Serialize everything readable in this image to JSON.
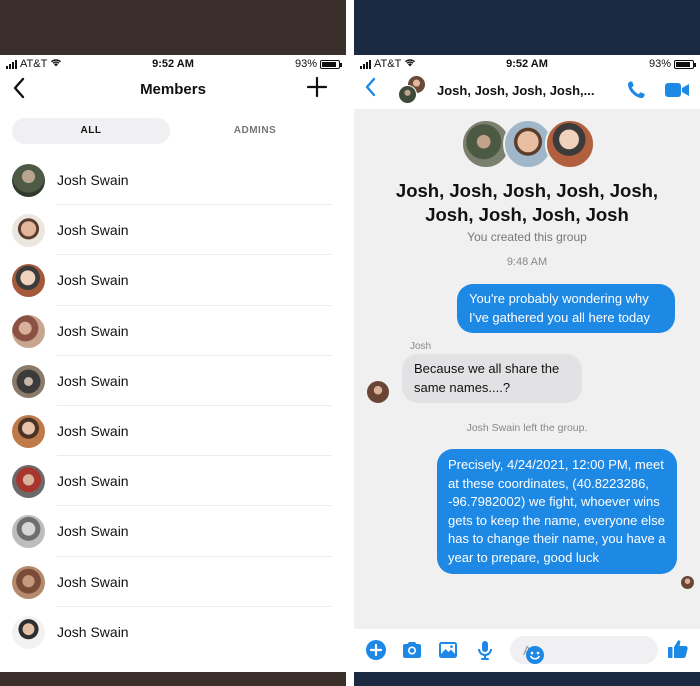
{
  "colors": {
    "accent": "#1e88e5",
    "outgoing_bubble": "#1e88e5",
    "incoming_bubble": "#e2e2e4",
    "chat_background": "#f0f0f0",
    "left_band": "#3a2f2a",
    "right_band": "#1c2942"
  },
  "left": {
    "status": {
      "carrier": "AT&T",
      "time": "9:52 AM",
      "battery": "93%"
    },
    "header": {
      "title": "Members",
      "back_icon": "chevron-left-icon",
      "add_icon": "plus-icon"
    },
    "tabs": [
      {
        "label": "ALL",
        "selected": true
      },
      {
        "label": "ADMINS",
        "selected": false
      }
    ],
    "members": [
      {
        "name": "Josh Swain"
      },
      {
        "name": "Josh Swain"
      },
      {
        "name": "Josh Swain"
      },
      {
        "name": "Josh Swain"
      },
      {
        "name": "Josh Swain"
      },
      {
        "name": "Josh Swain"
      },
      {
        "name": "Josh Swain"
      },
      {
        "name": "Josh Swain"
      },
      {
        "name": "Josh Swain"
      },
      {
        "name": "Josh Swain"
      }
    ]
  },
  "right": {
    "status": {
      "carrier": "AT&T",
      "time": "9:52 AM",
      "battery": "93%"
    },
    "header": {
      "title": "Josh, Josh, Josh, Josh,...",
      "back_icon": "chevron-left-icon",
      "call_icon": "phone-icon",
      "video_icon": "video-camera-icon"
    },
    "chat": {
      "group_name_line1": "Josh, Josh, Josh, Josh, Josh,",
      "group_name_line2": "Josh, Josh, Josh, Josh",
      "created_text": "You created this group",
      "timestamp": "9:48 AM",
      "messages": [
        {
          "direction": "outgoing",
          "text": "You're probably wondering why I've gathered you all here today"
        },
        {
          "direction": "incoming",
          "sender": "Josh",
          "text": "Because we all share the same names....?"
        },
        {
          "direction": "outgoing",
          "text": "Precisely, 4/24/2021, 12:00 PM, meet at these coordinates, (40.8223286, -96.7982002) we fight, whoever wins gets to keep the name, everyone else has to change their name, you have a year to prepare, good luck"
        }
      ],
      "notice": "Josh Swain left the group."
    },
    "composer": {
      "placeholder": "Aa",
      "icons": [
        "plus-circle-icon",
        "camera-icon",
        "image-icon",
        "microphone-icon",
        "emoji-icon",
        "thumbs-up-icon"
      ]
    }
  }
}
